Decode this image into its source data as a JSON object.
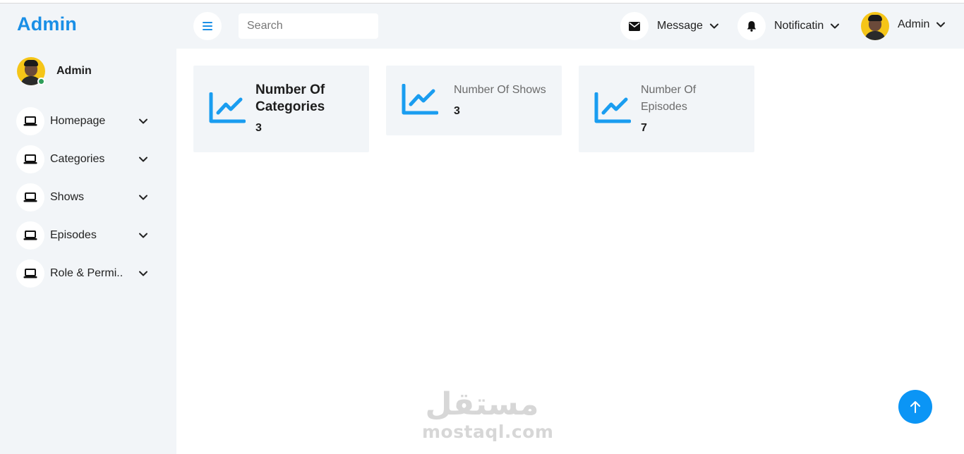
{
  "app": {
    "brand": "Admin"
  },
  "sidebar": {
    "profile": {
      "name": "Admin",
      "status": "online"
    },
    "items": [
      {
        "label": "Homepage",
        "icon": "laptop-icon"
      },
      {
        "label": "Categories",
        "icon": "laptop-icon"
      },
      {
        "label": "Shows",
        "icon": "laptop-icon"
      },
      {
        "label": "Episodes",
        "icon": "laptop-icon"
      },
      {
        "label": "Role & Permi..",
        "icon": "laptop-icon"
      }
    ]
  },
  "header": {
    "menu_icon": "hamburger-icon",
    "search": {
      "placeholder": "Search",
      "value": ""
    },
    "message": {
      "label": "Message",
      "icon": "envelope-icon"
    },
    "notification": {
      "label": "Notificatin",
      "icon": "bell-icon"
    },
    "user": {
      "label": "Admin"
    }
  },
  "cards": [
    {
      "title": "Number Of Categories",
      "value": "3",
      "icon": "chart-line-icon"
    },
    {
      "title": "Number Of Shows",
      "value": "3",
      "icon": "chart-line-icon"
    },
    {
      "title": "Number Of Episodes",
      "value": "7",
      "icon": "chart-line-icon"
    }
  ],
  "watermark": {
    "arabic": "مستقل",
    "latin": "mostaql.com"
  },
  "scroll_top": {
    "icon": "arrow-up-icon"
  },
  "colors": {
    "accent": "#1a8fe6",
    "panel_bg": "#f2f5f8",
    "scroll_button": "#0b95f5",
    "online": "#2e9e5a"
  }
}
